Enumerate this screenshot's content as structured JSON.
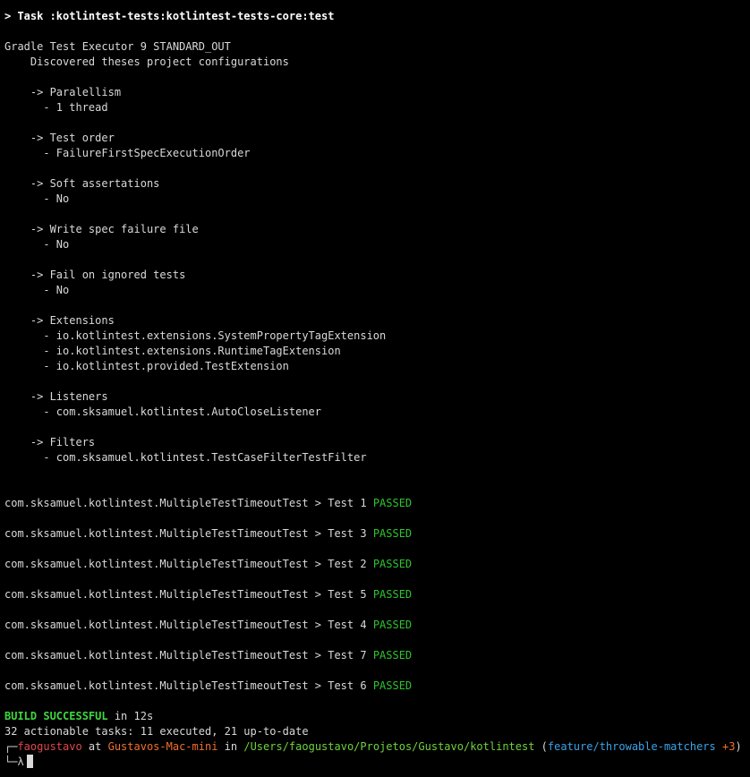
{
  "task_line": "> Task :kotlintest-tests:kotlintest-tests-core:test",
  "executor_line": "Gradle Test Executor 9 STANDARD_OUT",
  "discovered_line": "    Discovered theses project configurations",
  "config": {
    "parallelism_header": "    -> Paralellism",
    "parallelism_value": "      - 1 thread",
    "order_header": "    -> Test order",
    "order_value": "      - FailureFirstSpecExecutionOrder",
    "soft_header": "    -> Soft assertations",
    "soft_value": "      - No",
    "write_header": "    -> Write spec failure file",
    "write_value": "      - No",
    "ignored_header": "    -> Fail on ignored tests",
    "ignored_value": "      - No",
    "extensions_header": "    -> Extensions",
    "extensions": [
      "      - io.kotlintest.extensions.SystemPropertyTagExtension",
      "      - io.kotlintest.extensions.RuntimeTagExtension",
      "      - io.kotlintest.provided.TestExtension"
    ],
    "listeners_header": "    -> Listeners",
    "listeners_value": "      - com.sksamuel.kotlintest.AutoCloseListener",
    "filters_header": "    -> Filters",
    "filters_value": "      - com.sksamuel.kotlintest.TestCaseFilterTestFilter"
  },
  "tests": [
    {
      "prefix": "com.sksamuel.kotlintest.MultipleTestTimeoutTest > Test 1 ",
      "status": "PASSED"
    },
    {
      "prefix": "com.sksamuel.kotlintest.MultipleTestTimeoutTest > Test 3 ",
      "status": "PASSED"
    },
    {
      "prefix": "com.sksamuel.kotlintest.MultipleTestTimeoutTest > Test 2 ",
      "status": "PASSED"
    },
    {
      "prefix": "com.sksamuel.kotlintest.MultipleTestTimeoutTest > Test 5 ",
      "status": "PASSED"
    },
    {
      "prefix": "com.sksamuel.kotlintest.MultipleTestTimeoutTest > Test 4 ",
      "status": "PASSED"
    },
    {
      "prefix": "com.sksamuel.kotlintest.MultipleTestTimeoutTest > Test 7 ",
      "status": "PASSED"
    },
    {
      "prefix": "com.sksamuel.kotlintest.MultipleTestTimeoutTest > Test 6 ",
      "status": "PASSED"
    }
  ],
  "build": {
    "status": "BUILD SUCCESSFUL",
    "time": " in 12s",
    "summary": "32 actionable tasks: 11 executed, 21 up-to-date"
  },
  "prompt": {
    "corner_top": "┌─",
    "user": "faogustavo",
    "at": " at ",
    "host": "Gustavos-Mac-mini",
    "in": " in ",
    "path": "/Users/faogustavo/Projetos/Gustavo/kotlintest",
    "branch_open": " (",
    "branch": "feature/throwable-matchers",
    "dirty": " +3",
    "branch_close": ")",
    "corner_bottom": "└─λ"
  },
  "colors": {
    "background": "#000000",
    "text": "#d9d9d9",
    "passed": "#2fc32f",
    "user": "#e0484b",
    "host": "#f0702a",
    "path": "#6fd23d",
    "branch": "#3aa3e8"
  }
}
